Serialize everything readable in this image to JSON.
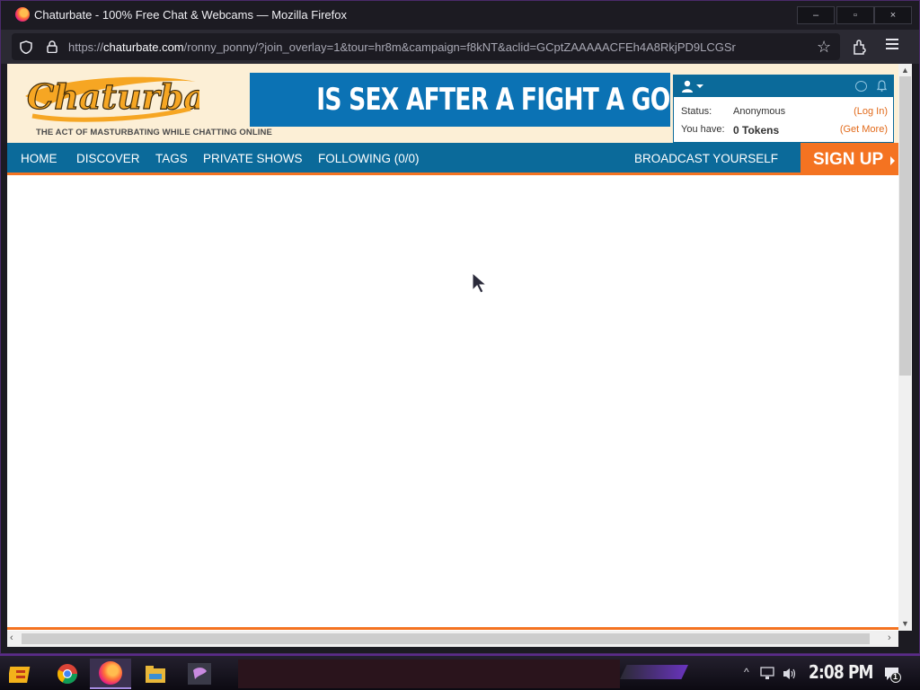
{
  "window": {
    "title": "Chaturbate - 100% Free Chat & Webcams — Mozilla Firefox",
    "minimize": "–",
    "maximize": "▫",
    "close": "×"
  },
  "browser": {
    "url_prefix": "https://",
    "url_domain": "chaturbate.com",
    "url_path": "/ronny_ponny/?join_overlay=1&tour=hr8m&campaign=f8kNT&aclid=GCptZAAAAACFEh4A8RkjPD9LCGSr"
  },
  "site": {
    "logo_text": "Chaturbate",
    "tagline": "THE ACT OF MASTURBATING WHILE CHATTING ONLINE",
    "ad_text": "IS SEX AFTER A FIGHT A GOOD IDEA?",
    "user_panel": {
      "status_label": "Status:",
      "status_value": "Anonymous",
      "login_link": "(Log In)",
      "tokens_label": "You have:",
      "tokens_value": "0 Tokens",
      "get_more_link": "(Get More)"
    },
    "nav": {
      "home": "HOME",
      "discover": "DISCOVER",
      "tags": "TAGS",
      "private_shows": "PRIVATE SHOWS",
      "following": "FOLLOWING (0/0)",
      "broadcast": "BROADCAST YOURSELF",
      "signup": "SIGN UP"
    }
  },
  "taskbar": {
    "clock": "2:08 PM",
    "notification_count": "1",
    "tray_chevron": "^"
  },
  "colors": {
    "nav_blue": "#0b6a9a",
    "accent_orange": "#f47321",
    "header_cream": "#fcefd6",
    "ad_blue": "#0b72b4",
    "link_orange": "#e26a1a"
  }
}
